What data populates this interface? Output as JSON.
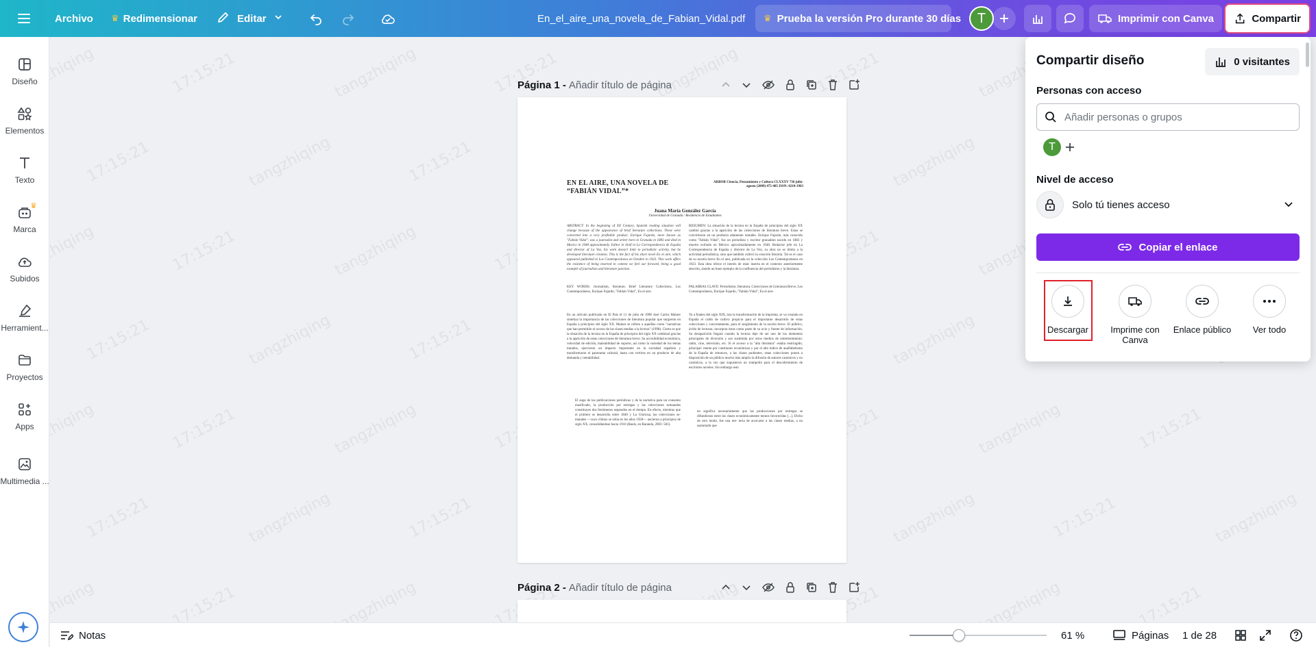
{
  "topbar": {
    "archivo": "Archivo",
    "redimensionar": "Redimensionar",
    "editar": "Editar",
    "filename": "En_el_aire_una_novela_de_Fabian_Vidal.pdf",
    "pro_trial": "Prueba la versión Pro durante 30 días",
    "avatar_letter": "T",
    "imprimir": "Imprimir con Canva",
    "compartir": "Compartir"
  },
  "sidebar": {
    "items": [
      {
        "label": "Diseño",
        "icon": "layout-icon"
      },
      {
        "label": "Elementos",
        "icon": "elements-icon"
      },
      {
        "label": "Texto",
        "icon": "text-icon"
      },
      {
        "label": "Marca",
        "icon": "brand-icon"
      },
      {
        "label": "Subidos",
        "icon": "upload-cloud-icon"
      },
      {
        "label": "Herramient...",
        "icon": "pen-tool-icon"
      },
      {
        "label": "Proyectos",
        "icon": "folder-icon"
      },
      {
        "label": "Apps",
        "icon": "apps-icon"
      },
      {
        "label": "Multimedia ...",
        "icon": "media-icon"
      }
    ]
  },
  "pages": [
    {
      "number": "Página 1 -",
      "title_placeholder": "Añadir título de página"
    },
    {
      "number": "Página 2 -",
      "title_placeholder": "Añadir título de página"
    }
  ],
  "watermark": {
    "user": "tangzhiqing",
    "time": "17:15:21"
  },
  "document": {
    "title": "EN EL AIRE, UNA NOVELA DE “FABIÁN VIDAL”*",
    "journal": "ARBOR Ciencia, Pensamiento y Cultura CLXXXV 736 julio-agosto (2009) 475-485 ISSN: 0210-1963",
    "author": "Juana María González García",
    "affiliation": "Universidad de Granada / Residencia de Estudiantes",
    "abstract": "ABSTRACT: In the beginning of XX Century, Spanish reading situation will change because of the appearance of brief literature collections. These were converted into a very profitable product. Enrique Fajardo, more known as \"Fabián Vidal\", was a journalist and writer born in Granada in 1883 and died in Mexico in 1948 approximately. Editor in chief in La Correspondencia de España and director of La Voz, his work doesn't limit to periodistic activity, but he developed literature creation. This is the fact of his short novel En el aire, which appeared published in Los Contemporáneos en Octubre in 1923. This work offers the existence of being inserted in context we feel our forward, being a good example of journalism and literature junction.",
    "keywords": "KEY WORDS: Journalism, literature, Brief Literature Collections, Los Contemporáneos, Enrique Fajardo, \"Fabián Vidal\", En el aire.",
    "resumen": "RESUMEN: La situación de la lectura en la España de principios del siglo XX cambió gracias a la aparición de las colecciones de literatura breve. Estas se convirtieron en un producto altamente rentable. Enrique Fajardo, más conocido como \"Fabián Vidal\", fue un periodista y escritor granadino nacido en 1883 y muerto exiliado en México aproximadamente en 1948. Redactor jefe en La Correspondencia de España y director de La Voz, su obra no se limita a la actividad periodística, sino que también cultivó la creación literaria. Tal es el caso de su novela breve En el aire, publicada en la colección Los Contemporáneos en 1923. Esta obra ofrece el interés de estar inserta en el contexto anteriormente descrito, siendo un buen ejemplo de la confluencia del periodismo y la literatura.",
    "palabras": "PALABRAS CLAVE: Periodismo, literatura, Colecciones de Literatura Breve, Los Contemporáneos, Enrique Fajardo, \"Fabián Vidal\", En el aire.",
    "body_left": "En un artículo publicado en El País el 11 de julio de 1998 José Carlos Mainer sintetiza la importancia de las colecciones de literatura popular que surgieron en España a principios del siglo XX. Mainer se refiere a aquéllas como \"narrativas que han permitido el acceso de las clases medias a la lectura\" (1998). Cierto es que la situación de la lectura en la España de principios del siglo XX cambiará gracias a la aparición de estas colecciones de literatura breve. Su accesibilidad económica, velocidad de edición, maleabilidad de soporte, así como la variedad de los temas tratados, ejercieron un impacto importante en la sociedad española y transformaron el panorama cultural, hasta con vertirse en un producto de alta demanda y rentabilidad.",
    "quote_left": "El auge de las publicaciones periódicas y de la narrativa para un consumo masificado, la producción por entregas y las colecciones semanales constituyen dos fenómenos separados en el tiempo. En efecto, mientras que el primero se desarrolla entre 1840 y La Gloriosa, las colecciones se- manales —cuyo clímax se sitúa en los años 1920— nacieron a principios de siglo XX, consolidándose hacia 1910 (Bauls, en Baranda, 2003: 581).",
    "body_right": "Ya a finales del siglo XIX, tras la transformación de la imprenta, se va creando en España el caldo de cultivo propicio para el importante desarrollo de estas colecciones y concretamente, para el surgimiento de la novela breve. El público, ávido de lecturas, incorpora éstas como parte de su ocio y fuente de información. Su desaparición llegará cuando la lectura deje de ser uno de los elementos principales de diversión y sea sustituida por otros medios de entretenimiento: radio, cine, televisión, etc. Si el acceso a la \"alta literatura\" estaba restringido, principal- mente por cuestiones económicas y por el alto índice de analfabetismo de la España de entonces, a las clases pudientes, estas colecciones ponen a disposición de un público mucho más amplio la difusión de autores canónicos y no canónicos, a la vez que supusieron un trampolín para el descubrimiento de escritores noveles. Sin embargo esto",
    "quote_right": "no significa necesariamente que las producciones por entregas se difundieran entre las clases económicamente menos favorecidas [...]. Dicho de otro modo, fue una me- teria de acercarse a las clases medias, a un asalariado que"
  },
  "bottombar": {
    "notas": "Notas",
    "zoom": "61 %",
    "zoom_fraction": 0.36,
    "paginas": "Páginas",
    "page_count": "1 de 28"
  },
  "share_panel": {
    "title": "Compartir diseño",
    "visitors": "0 visitantes",
    "people_label": "Personas con acceso",
    "search_placeholder": "Añadir personas o grupos",
    "avatar_letter": "T",
    "access_label": "Nivel de acceso",
    "access_value": "Solo tú tienes acceso",
    "copy_link": "Copiar el enlace",
    "actions": [
      {
        "label": "Descargar",
        "icon": "download-icon"
      },
      {
        "label": "Imprime con Canva",
        "icon": "truck-icon"
      },
      {
        "label": "Enlace público",
        "icon": "link-icon"
      },
      {
        "label": "Ver todo",
        "icon": "more-icon"
      }
    ]
  },
  "colors": {
    "purple": "#7d2ae8",
    "avatar_green": "#4c9a3a",
    "highlight_red": "#e0202a"
  }
}
